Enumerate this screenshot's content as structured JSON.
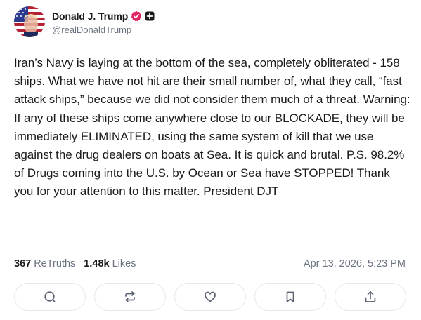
{
  "author": {
    "display_name": "Donald J. Trump",
    "handle": "@realDonaldTrump",
    "verified_badge_color": "#e0245e"
  },
  "post": {
    "text": "Iran’s Navy is laying at the bottom of the sea, completely obliterated - 158 ships. What we have not hit are their small number of, what they call, “fast attack ships,” because we did not consider them much of a threat. Warning: If any of these ships come anywhere close to our BLOCKADE, they will be immediately ELIMINATED, using the same system of kill that we use against the drug dealers on boats at Sea. It is quick and brutal. P.S. 98.2% of Drugs coming into the U.S. by Ocean or Sea have STOPPED! Thank you for your attention to this matter. President DJT"
  },
  "stats": {
    "retruths_count": "367",
    "retruths_label": "ReTruths",
    "likes_count": "1.48k",
    "likes_label": "Likes",
    "timestamp": "Apr 13, 2026, 5:23 PM"
  },
  "actions": [
    {
      "icon": "reply-icon"
    },
    {
      "icon": "retruth-icon"
    },
    {
      "icon": "like-heart-icon"
    },
    {
      "icon": "bookmark-icon"
    },
    {
      "icon": "share-icon"
    }
  ]
}
